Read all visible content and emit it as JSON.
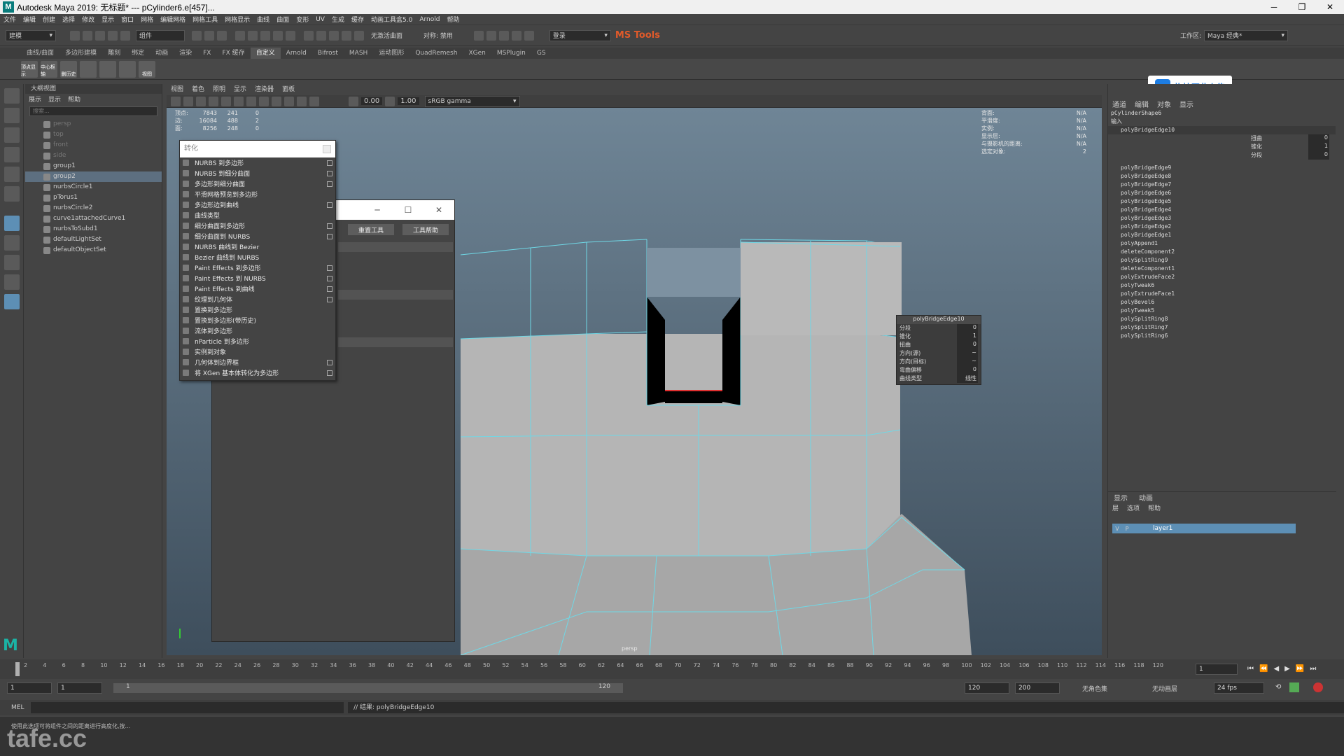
{
  "window": {
    "title": "Autodesk Maya 2019: 无标题*  ---  pCylinder6.e[457]...",
    "logo": "M",
    "controls": [
      "─",
      "❐",
      "✕"
    ]
  },
  "menubar": [
    "文件",
    "编辑",
    "创建",
    "选择",
    "修改",
    "显示",
    "窗口",
    "网格",
    "编辑网格",
    "网格工具",
    "网格显示",
    "曲线",
    "曲面",
    "变形",
    "UV",
    "生成",
    "缓存",
    "动画工具盒5.0",
    "Arnold",
    "帮助"
  ],
  "statusline": {
    "mode": "建模",
    "component_label": "组件",
    "no_live": "无激活曲面",
    "symmetry": "对称: 禁用",
    "login": "登录",
    "mstools": "MS Tools",
    "workspace_label": "工作区:",
    "workspace": "Maya 经典*"
  },
  "shelf": {
    "tabs": [
      "曲线/曲面",
      "多边形建模",
      "雕刻",
      "绑定",
      "动画",
      "渲染",
      "FX",
      "FX 缓存",
      "自定义",
      "Arnold",
      "Bifrost",
      "MASH",
      "运动图形",
      "QuadRemesh",
      "XGen",
      "MSPlugin",
      "GS"
    ],
    "active_tab": "自定义",
    "icons": [
      "顶点显示",
      "中心枢轴",
      "删历史",
      "",
      "",
      "",
      "视图"
    ]
  },
  "outliner": {
    "title": "大纲视图",
    "menu": [
      "展示",
      "显示",
      "帮助"
    ],
    "search": "搜索...",
    "items": [
      {
        "label": "persp",
        "dim": true
      },
      {
        "label": "top",
        "dim": true
      },
      {
        "label": "front",
        "dim": true
      },
      {
        "label": "side",
        "dim": true
      },
      {
        "label": "group1",
        "dim": false
      },
      {
        "label": "group2",
        "dim": false
      },
      {
        "label": "nurbsCircle1",
        "dim": false
      },
      {
        "label": "pTorus1",
        "dim": false
      },
      {
        "label": "nurbsCircle2",
        "dim": false
      },
      {
        "label": "curve1attachedCurve1",
        "dim": false
      },
      {
        "label": "nurbsToSubd1",
        "dim": false
      },
      {
        "label": "defaultLightSet",
        "dim": false
      },
      {
        "label": "defaultObjectSet",
        "dim": false
      }
    ]
  },
  "viewport": {
    "menu": [
      "视图",
      "着色",
      "照明",
      "显示",
      "渲染器",
      "面板"
    ],
    "field1": "0.00",
    "field2": "1.00",
    "colorspace": "sRGB gamma",
    "camera_label": "persp",
    "hud_left": [
      {
        "k": "顶点:",
        "a": "7843",
        "b": "241",
        "c": "0"
      },
      {
        "k": "边:",
        "a": "16084",
        "b": "488",
        "c": "2"
      },
      {
        "k": "面:",
        "a": "8256",
        "b": "248",
        "c": "0"
      }
    ],
    "hud_right": [
      {
        "k": "背面:",
        "v": "N/A"
      },
      {
        "k": "平滑度:",
        "v": "N/A"
      },
      {
        "k": "实例:",
        "v": "N/A"
      },
      {
        "k": "显示层:",
        "v": "N/A"
      },
      {
        "k": "与摄影机的距离:",
        "v": "N/A"
      },
      {
        "k": "选定对象:",
        "v": "2"
      }
    ]
  },
  "convert_menu": {
    "title": "转化",
    "items": [
      {
        "label": "NURBS 到多边形",
        "opt": true
      },
      {
        "label": "NURBS 到细分曲面",
        "opt": true
      },
      {
        "label": "多边形到细分曲面",
        "opt": true
      },
      {
        "label": "平滑网格预览到多边形",
        "opt": false
      },
      {
        "label": "多边形边到曲线",
        "opt": true
      },
      {
        "label": "曲线类型",
        "opt": false
      },
      {
        "label": "细分曲面到多边形",
        "opt": true
      },
      {
        "label": "细分曲面到 NURBS",
        "opt": true
      },
      {
        "label": "NURBS 曲线到 Bezier",
        "opt": false
      },
      {
        "label": "Bezier 曲线到 NURBS",
        "opt": false
      },
      {
        "label": "Paint Effects 到多边形",
        "opt": true
      },
      {
        "label": "Paint Effects 到 NURBS",
        "opt": true
      },
      {
        "label": "Paint Effects 到曲线",
        "opt": true
      },
      {
        "label": "纹理到几何体",
        "opt": true
      },
      {
        "label": "置换到多边形",
        "opt": false
      },
      {
        "label": "置换到多边形(带历史)",
        "opt": false
      },
      {
        "label": "流体到多边形",
        "opt": false
      },
      {
        "label": "nParticle 到多边形",
        "opt": false
      },
      {
        "label": "实例到对象",
        "opt": false
      },
      {
        "label": "几何体到边界框",
        "opt": true
      },
      {
        "label": "将 XGen 基本体转化为多边形",
        "opt": true
      }
    ]
  },
  "float_window": {
    "controls": [
      "─",
      "☐",
      "✕"
    ],
    "reset": "重置工具",
    "help": "工具帮助"
  },
  "node_box": {
    "title": "polyBridgeEdge10",
    "rows": [
      {
        "k": "分段",
        "v": "0"
      },
      {
        "k": "锥化",
        "v": "1"
      },
      {
        "k": "扭曲",
        "v": "0"
      },
      {
        "k": "方向(源)",
        "v": "~"
      },
      {
        "k": "方向(目标)",
        "v": "~"
      },
      {
        "k": "弯曲偏移",
        "v": "0"
      },
      {
        "k": "曲线类型",
        "v": "线性"
      }
    ]
  },
  "upload_button": "拖拽至此上传",
  "channel_box": {
    "tabs": [
      "通道",
      "编辑",
      "对象",
      "显示"
    ],
    "shape": "pCylinderShape6",
    "inputs_label": "输入",
    "selected_node": "polyBridgeEdge10",
    "attrs": [
      {
        "k": "扭曲",
        "v": "0"
      },
      {
        "k": "锥化",
        "v": "1"
      },
      {
        "k": "分段",
        "v": "0"
      }
    ],
    "history": [
      "polyBridgeEdge9",
      "polyBridgeEdge8",
      "polyBridgeEdge7",
      "polyBridgeEdge6",
      "polyBridgeEdge5",
      "polyBridgeEdge4",
      "polyBridgeEdge3",
      "polyBridgeEdge2",
      "polyBridgeEdge1",
      "polyAppend1",
      "deleteComponent2",
      "polySplitRing9",
      "deleteComponent1",
      "polyExtrudeFace2",
      "polyTweak6",
      "polyExtrudeFace1",
      "polyBevel6",
      "polyTweak5",
      "polySplitRing8",
      "polySplitRing7",
      "polySplitRing6"
    ]
  },
  "layer_editor": {
    "tabs": [
      "显示",
      "动画"
    ],
    "menu": [
      "层",
      "选项",
      "帮助"
    ],
    "layer": "layer1",
    "flags": [
      "V",
      "P"
    ]
  },
  "timeline": {
    "ticks": [
      "2",
      "4",
      "6",
      "8",
      "10",
      "12",
      "14",
      "16",
      "18",
      "20",
      "22",
      "24",
      "26",
      "28",
      "30",
      "32",
      "34",
      "36",
      "38",
      "40",
      "42",
      "44",
      "46",
      "48",
      "50",
      "52",
      "54",
      "56",
      "58",
      "60",
      "62",
      "64",
      "66",
      "68",
      "70",
      "72",
      "74",
      "76",
      "78",
      "80",
      "82",
      "84",
      "86",
      "88",
      "90",
      "92",
      "94",
      "96",
      "98",
      "100",
      "102",
      "104",
      "106",
      "108",
      "110",
      "112",
      "114",
      "116",
      "118",
      "120"
    ],
    "current": "1"
  },
  "range": {
    "start": "1",
    "start2": "1",
    "slider_start": "1",
    "slider_end": "120",
    "end": "120",
    "end2": "200",
    "char_set": "无角色集",
    "anim_layer": "无动画层",
    "fps": "24 fps"
  },
  "cmdline": {
    "lang": "MEL",
    "result": "// 结果: polyBridgeEdge10"
  },
  "helpline": "使用此选项可将组件之间的距离进行高度化,按... ",
  "watermark": "tafe.cc"
}
